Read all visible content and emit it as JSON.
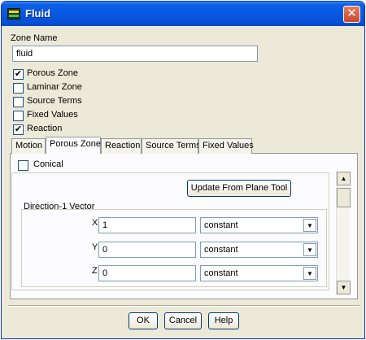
{
  "window": {
    "title": "Fluid",
    "close_glyph": "✕"
  },
  "zone_name": {
    "label": "Zone Name",
    "value": "fluid"
  },
  "options": [
    {
      "label": "Porous Zone",
      "checked": true
    },
    {
      "label": "Laminar Zone",
      "checked": false
    },
    {
      "label": "Source Terms",
      "checked": false
    },
    {
      "label": "Fixed Values",
      "checked": false
    },
    {
      "label": "Reaction",
      "checked": true
    }
  ],
  "tabs": [
    {
      "label": "Motion",
      "active": false
    },
    {
      "label": "Porous Zone",
      "active": true
    },
    {
      "label": "Reaction",
      "active": false
    },
    {
      "label": "Source Terms",
      "active": false
    },
    {
      "label": "Fixed Values",
      "active": false
    }
  ],
  "porous": {
    "conical_label": "Conical",
    "conical_checked": false,
    "update_button": "Update From Plane Tool",
    "direction_label": "Direction-1 Vector",
    "rows": [
      {
        "axis": "X",
        "value": "1",
        "method": "constant"
      },
      {
        "axis": "Y",
        "value": "0",
        "method": "constant"
      },
      {
        "axis": "Z",
        "value": "0",
        "method": "constant"
      }
    ]
  },
  "buttons": {
    "ok": "OK",
    "cancel": "Cancel",
    "help": "Help"
  },
  "icons": {
    "close": "close-icon",
    "app": "fluent-app-icon",
    "dropdown": "chevron-down-icon",
    "check": "checkmark-icon"
  },
  "colors": {
    "titlebar": "#0858e0",
    "dialog_bg": "#ece9d8",
    "close_button": "#c94a2c"
  }
}
